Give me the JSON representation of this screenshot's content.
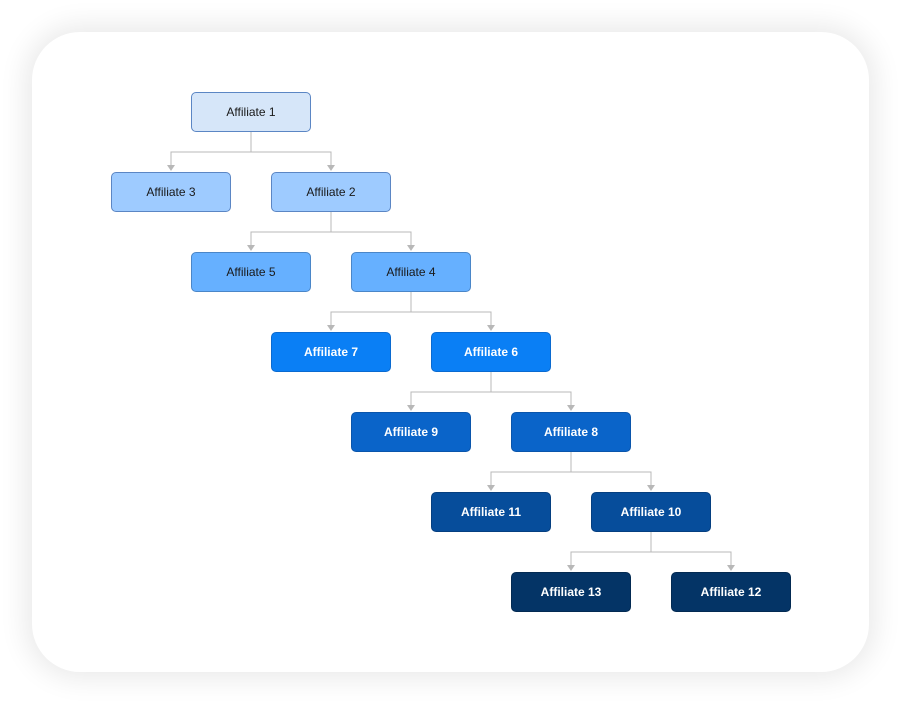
{
  "diagram": {
    "type": "org-tree",
    "nodes": [
      {
        "id": "a1",
        "label": "Affiliate 1",
        "level": 0,
        "fill": "#d6e6f9",
        "border": "#5b86c4",
        "text": "#1a1a1a"
      },
      {
        "id": "a3",
        "label": "Affiliate 3",
        "level": 1,
        "fill": "#9ecbff",
        "border": "#5b86c4",
        "text": "#1a1a1a",
        "parent": "a1"
      },
      {
        "id": "a2",
        "label": "Affiliate 2",
        "level": 1,
        "fill": "#9ecbff",
        "border": "#5b86c4",
        "text": "#1a1a1a",
        "parent": "a1"
      },
      {
        "id": "a5",
        "label": "Affiliate 5",
        "level": 2,
        "fill": "#66b0ff",
        "border": "#4a86c8",
        "text": "#1a1a1a",
        "parent": "a2"
      },
      {
        "id": "a4",
        "label": "Affiliate 4",
        "level": 2,
        "fill": "#66b0ff",
        "border": "#4a86c8",
        "text": "#1a1a1a",
        "parent": "a2"
      },
      {
        "id": "a7",
        "label": "Affiliate 7",
        "level": 3,
        "fill": "#0a7ff5",
        "border": "#0a6ad0",
        "text": "#ffffff",
        "parent": "a4"
      },
      {
        "id": "a6",
        "label": "Affiliate 6",
        "level": 3,
        "fill": "#0a7ff5",
        "border": "#0a6ad0",
        "text": "#ffffff",
        "parent": "a4"
      },
      {
        "id": "a9",
        "label": "Affiliate 9",
        "level": 4,
        "fill": "#0a64c9",
        "border": "#0a55ab",
        "text": "#ffffff",
        "parent": "a6"
      },
      {
        "id": "a8",
        "label": "Affiliate 8",
        "level": 4,
        "fill": "#0a64c9",
        "border": "#0a55ab",
        "text": "#ffffff",
        "parent": "a6"
      },
      {
        "id": "a11",
        "label": "Affiliate 11",
        "level": 5,
        "fill": "#064d9b",
        "border": "#053f80",
        "text": "#ffffff",
        "parent": "a8"
      },
      {
        "id": "a10",
        "label": "Affiliate 10",
        "level": 5,
        "fill": "#064d9b",
        "border": "#053f80",
        "text": "#ffffff",
        "parent": "a8"
      },
      {
        "id": "a13",
        "label": "Affiliate 13",
        "level": 6,
        "fill": "#043466",
        "border": "#032a52",
        "text": "#ffffff",
        "parent": "a10"
      },
      {
        "id": "a12",
        "label": "Affiliate 12",
        "level": 6,
        "fill": "#043466",
        "border": "#032a52",
        "text": "#ffffff",
        "parent": "a10"
      }
    ],
    "link_color": "#b8b8b8"
  }
}
